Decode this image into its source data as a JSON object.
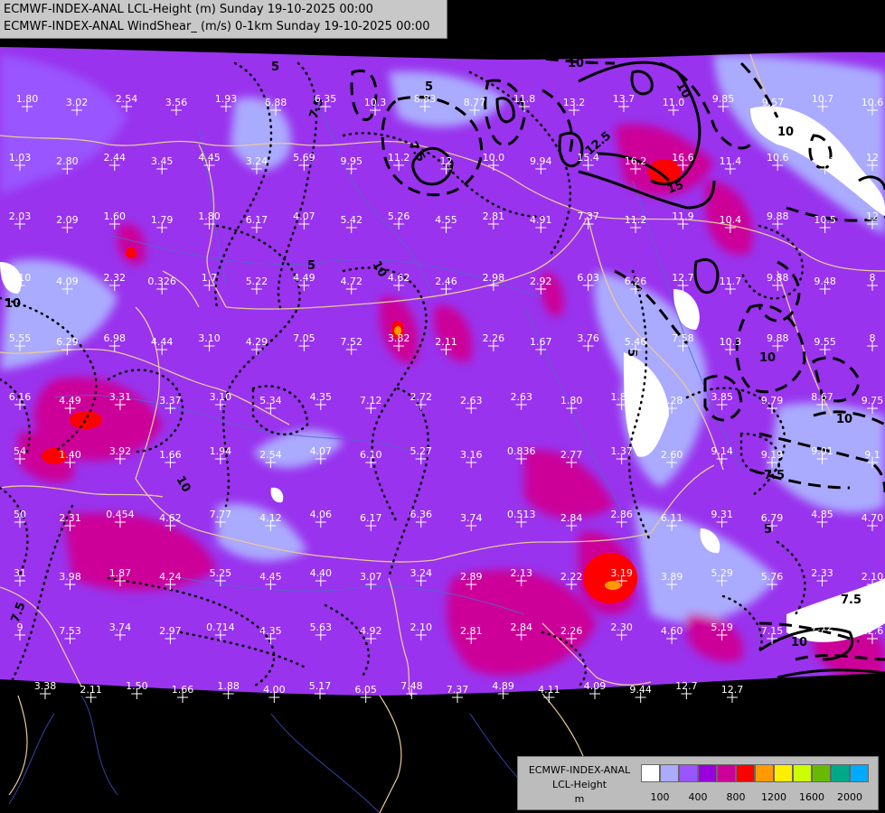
{
  "title": {
    "line1": "ECMWF-INDEX-ANAL LCL-Height (m) Sunday 19-10-2025 00:00",
    "line2": "ECMWF-INDEX-ANAL WindShear_ (m/s) 0-1km Sunday 19-10-2025 00:00"
  },
  "legend": {
    "line1": "ECMWF-INDEX-ANAL",
    "line2": "LCL-Height",
    "line3": "m",
    "colors": [
      "#ffffff",
      "#aaaaff",
      "#9955ff",
      "#9900dd",
      "#cc0099",
      "#ff0000",
      "#ff9900",
      "#ffee00",
      "#ccff00",
      "#66bb00",
      "#00aa88",
      "#00aaff"
    ],
    "ticks": [
      {
        "label": "100",
        "pos": 1
      },
      {
        "label": "400",
        "pos": 3
      },
      {
        "label": "800",
        "pos": 5
      },
      {
        "label": "1200",
        "pos": 7
      },
      {
        "label": "1600",
        "pos": 9
      },
      {
        "label": "2000",
        "pos": 11
      }
    ]
  },
  "colors": {
    "background": "#000000",
    "base_field": "#9933ee",
    "borders": "#e8c89a",
    "rivers": "#5566cc",
    "contours": "#000000"
  },
  "values": [
    "1.80",
    "3.02",
    "2.54",
    "3.56",
    "1.93",
    "6.88",
    "6.35",
    "10.3",
    "8.83",
    "8.77",
    "11.8",
    "13.2",
    "13.7",
    "11.0",
    "9.85",
    "9.57",
    "10.7",
    "10.6",
    "1.03",
    "2.80",
    "2.44",
    "3.45",
    "4.45",
    "3.24",
    "5.69",
    "9.95",
    "11.2",
    "12",
    "10.0",
    "9.94",
    "15.4",
    "16.2",
    "16.6",
    "11.4",
    "10.6",
    "10.2",
    "12",
    "2.03",
    "2.09",
    "1.60",
    "1.79",
    "1.80",
    "6.17",
    "4.07",
    "5.42",
    "5.26",
    "4.55",
    "2.81",
    "4.91",
    "7.37",
    "11.2",
    "11.9",
    "10.4",
    "9.88",
    "10.5",
    "12",
    "4.10",
    "4.09",
    "2.32",
    "0.326",
    "1.7",
    "5.22",
    "4.49",
    "4.72",
    "4.62",
    "2.46",
    "2.98",
    "2.92",
    "6.03",
    "6.26",
    "12.7",
    "11.7",
    "9.88",
    "9.48",
    "8",
    "5.55",
    "6.29",
    "6.98",
    "4.44",
    "3.10",
    "4.29",
    "7.05",
    "7.52",
    "3.82",
    "2.11",
    "2.26",
    "1.67",
    "3.76",
    "5.46",
    "7.58",
    "10.3",
    "9.88",
    "9.55",
    "8",
    "6.16",
    "4.49",
    "3.31",
    "3.37",
    "3.10",
    "5.34",
    "4.35",
    "7.12",
    "2.72",
    "2.63",
    "2.63",
    "1.80",
    "1.85",
    "5.28",
    "3.85",
    "9.79",
    "8.67",
    "9.75",
    "54",
    "1.40",
    "3.92",
    "1.66",
    "1.94",
    "2.54",
    "4.07",
    "6.10",
    "5.27",
    "3.16",
    "0.836",
    "2.77",
    "1.37",
    "2.60",
    "9.14",
    "9.19",
    "9.01",
    "9.1",
    "50",
    "2.31",
    "0.454",
    "4.62",
    "7.77",
    "4.12",
    "4.06",
    "6.17",
    "6.36",
    "3.74",
    "0.513",
    "2.84",
    "2.86",
    "6.11",
    "9.31",
    "6.79",
    "4.85",
    "4.70",
    "31",
    "3.98",
    "1.87",
    "4.24",
    "5.25",
    "4.45",
    "4.40",
    "3.07",
    "3.24",
    "2.89",
    "2.13",
    "2.22",
    "3.19",
    "3.89",
    "5.29",
    "5.76",
    "2.33",
    "2.10",
    "9",
    "7.53",
    "3.74",
    "2.97",
    "0.714",
    "4.35",
    "5.63",
    "4.92",
    "2.10",
    "2.81",
    "2.84",
    "2.26",
    "2.30",
    "4.60",
    "5.19",
    "7.15",
    "7.12",
    "12.6",
    "3.38",
    "2.11",
    "1.50",
    "1.66",
    "1.88",
    "4.00",
    "5.17",
    "6.05",
    "7.48",
    "7.37",
    "4.89",
    "4.11",
    "4.09",
    "9.44",
    "12.7",
    "12.7"
  ],
  "contour_labels": [
    "5",
    "7.5",
    "5",
    "10",
    "10",
    "7.5",
    "12.5",
    "15",
    "10",
    "5",
    "10",
    "10",
    "5",
    "10",
    "10",
    "7.5",
    "10",
    "7.5",
    "5",
    "7.5"
  ]
}
